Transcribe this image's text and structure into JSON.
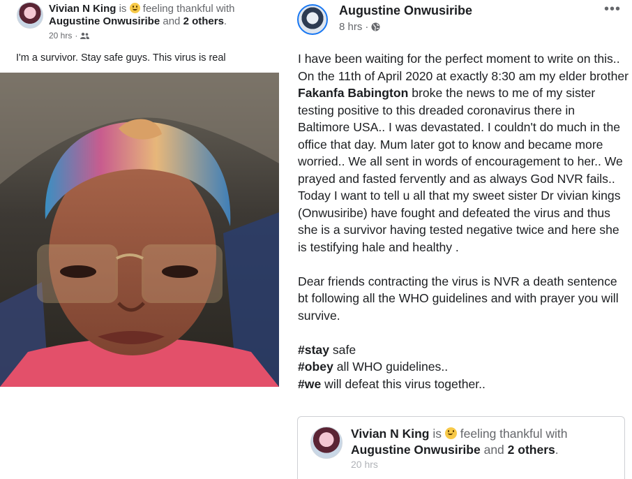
{
  "left_post": {
    "author": "Vivian N King",
    "is_text": "is",
    "feeling_text": "feeling thankful with",
    "tagged_name": "Augustine Onwusiribe",
    "and_text": "and",
    "others": "2 others",
    "period": ".",
    "time": "20 hrs",
    "privacy_icon": "friends-icon",
    "text": "I'm a survivor. Stay safe guys. This virus is real"
  },
  "right_post": {
    "author": "Augustine Onwusiribe",
    "time": "8 hrs",
    "privacy_icon": "globe-icon",
    "more": "•••",
    "p1_a": "I have been waiting for the perfect moment to write on this.. On the 11th of April 2020 at exactly 8:30 am my elder brother ",
    "p1_b": "Fakanfa Babington",
    "p1_c": " broke the news to me of my sister testing positive to this dreaded coronavirus there in Baltimore USA.. I was devastated. I couldn't do much in the office that day. Mum later got to know and became more worried.. We all sent in words of encouragement to her.. We prayed and fasted fervently and as always God NVR fails.. Today I want to tell u all that my sweet sister Dr vivian kings (Onwusiribe) have fought and defeated the virus and thus she is a survivor having tested negative twice and here she is testifying hale and healthy .",
    "p2": "Dear friends contracting the virus is NVR a death sentence bt following all the WHO guidelines and with prayer you will survive.",
    "hashtags": [
      {
        "tag": "#stay",
        "rest": " safe"
      },
      {
        "tag": "#obey",
        "rest": " all WHO guidelines.."
      },
      {
        "tag": "#we",
        "rest": " will defeat this virus together.."
      }
    ]
  },
  "shared_post": {
    "author": "Vivian N King",
    "is_text": "is",
    "feeling_text": "feeling thankful with",
    "tagged_name": "Augustine Onwusiribe",
    "and_text": "and",
    "others": "2 others",
    "period": ".",
    "time": "20 hrs"
  }
}
